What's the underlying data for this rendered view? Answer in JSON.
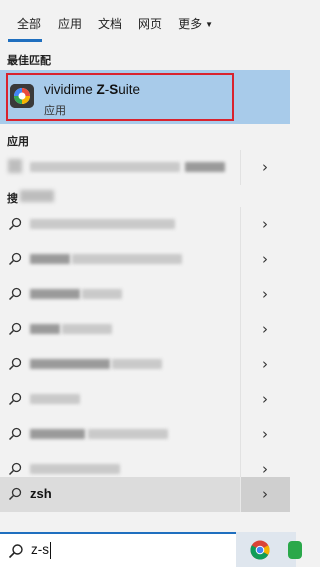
{
  "tabs": [
    {
      "label": "全部",
      "active": true
    },
    {
      "label": "应用",
      "active": false
    },
    {
      "label": "文档",
      "active": false
    },
    {
      "label": "网页",
      "active": false
    },
    {
      "label": "更多",
      "active": false
    }
  ],
  "sections": {
    "best_match": "最佳匹配",
    "apps": "应用",
    "search": "搜"
  },
  "best_match": {
    "title_prefix": "vividime ",
    "title_bold1": "Z",
    "title_sep": "-",
    "title_bold2": "S",
    "title_rest": "uite",
    "subtitle": "应用"
  },
  "suggestion": {
    "label": "zsh"
  },
  "search": {
    "value": "z-s"
  },
  "colors": {
    "accent": "#1f6fbf",
    "best_bg": "#a8cbea",
    "highlight_outline": "#d9232e"
  }
}
